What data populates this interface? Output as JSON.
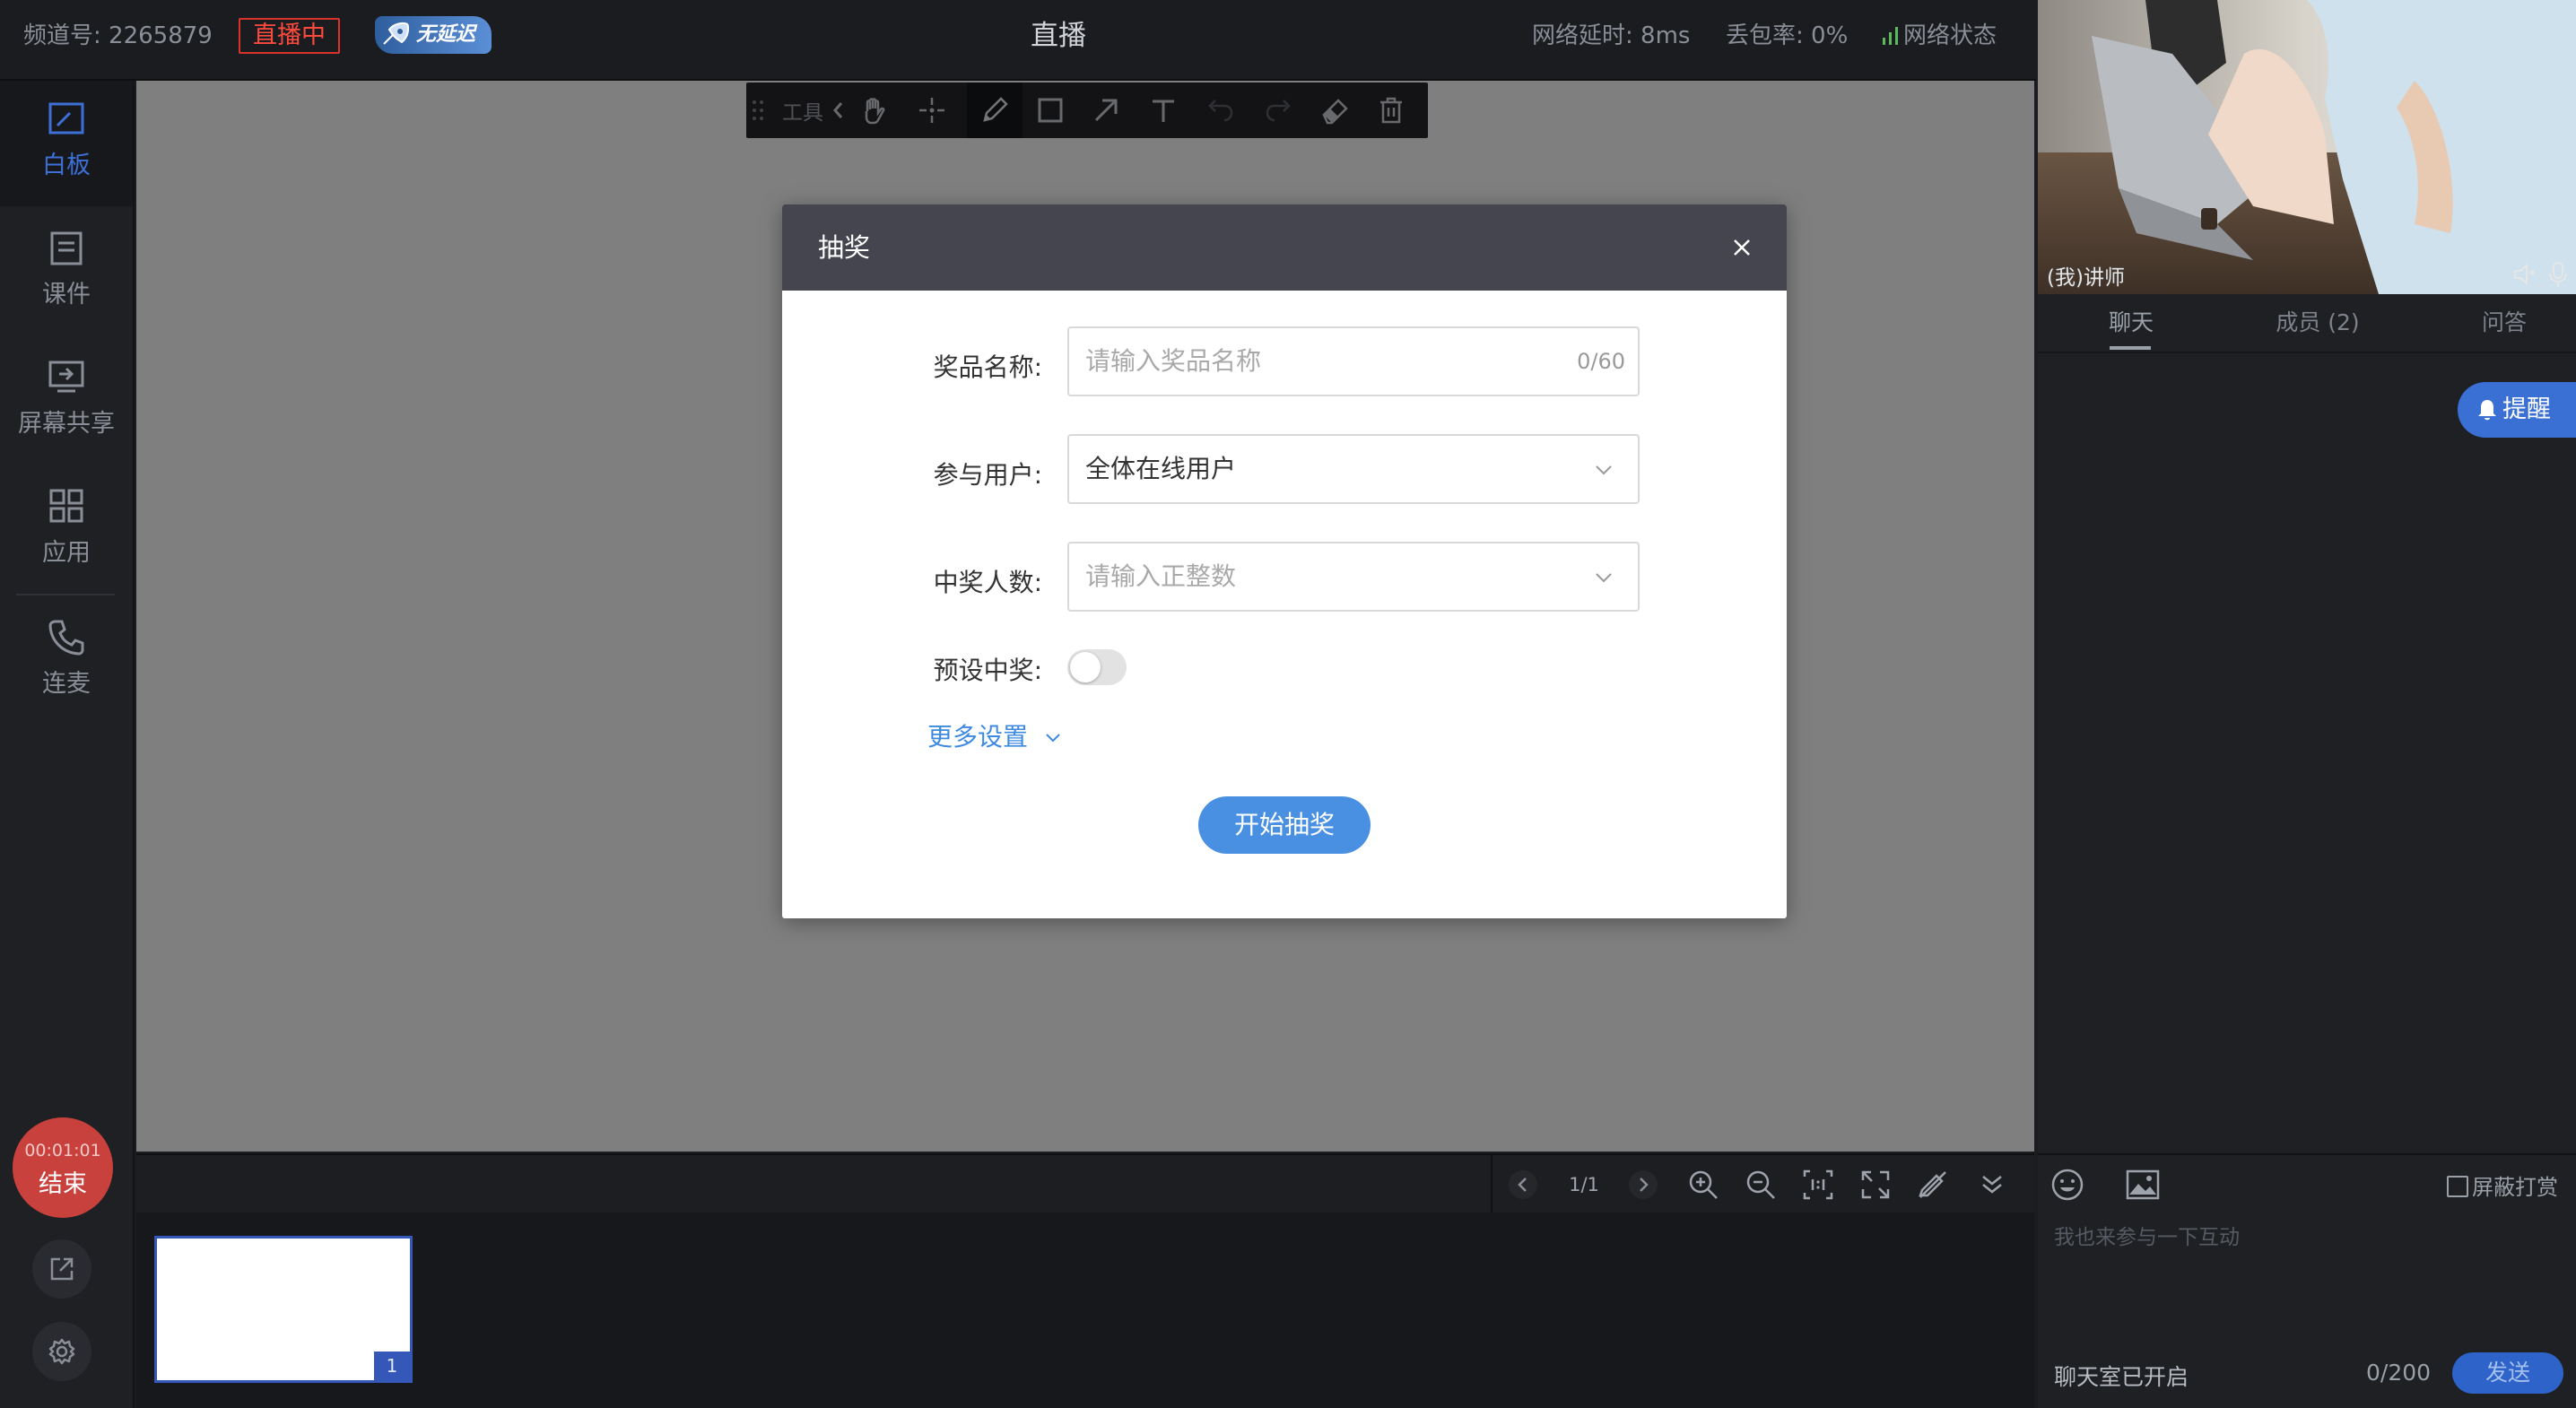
{
  "topbar": {
    "channel": "频道号: 2265879",
    "live_status": "直播中",
    "nodelay_badge": "无延迟",
    "title": "直播",
    "latency": "网络延时: 8ms",
    "packet_loss": "丢包率: 0%",
    "network_status": "网络状态"
  },
  "sidebar": {
    "items": [
      {
        "label": "白板",
        "icon": "whiteboard-icon",
        "active": true
      },
      {
        "label": "课件",
        "icon": "courseware-icon"
      },
      {
        "label": "屏幕共享",
        "icon": "screen-share-icon"
      },
      {
        "label": "应用",
        "icon": "apps-icon"
      },
      {
        "label": "连麦",
        "icon": "phone-icon"
      }
    ],
    "timer": "00:01:01",
    "end_label": "结束"
  },
  "toolbar": {
    "label": "工具",
    "icons": [
      "grip-icon",
      "collapse-icon",
      "hand-icon",
      "laser-pointer-icon",
      "pen-icon",
      "rectangle-icon",
      "arrow-icon",
      "text-icon",
      "undo-icon",
      "redo-icon",
      "eraser-icon",
      "trash-icon"
    ]
  },
  "board": {
    "page_indicator": "1/1",
    "thumbnail_number": "1"
  },
  "right_panel": {
    "video_label": "(我)讲师",
    "tabs": [
      "聊天",
      "成员 (2)",
      "问答"
    ],
    "remind_label": "提醒",
    "block_tip_label": "屏蔽打赏",
    "chat_placeholder": "我也来参与一下互动",
    "chat_status": "聊天室已开启",
    "char_count": "0/200",
    "send_label": "发送"
  },
  "modal": {
    "title": "抽奖",
    "prize_label": "奖品名称:",
    "prize_placeholder": "请输入奖品名称",
    "prize_count": "0/60",
    "users_label": "参与用户:",
    "users_value": "全体在线用户",
    "winners_label": "中奖人数:",
    "winners_placeholder": "请输入正整数",
    "preset_label": "预设中奖:",
    "preset_enabled": false,
    "more_settings": "更多设置",
    "start_button": "开始抽奖"
  },
  "colors": {
    "accent": "#4a90e2",
    "live": "#ff4b3e",
    "end_button": "#c9413d",
    "modal_header": "#45454f"
  }
}
